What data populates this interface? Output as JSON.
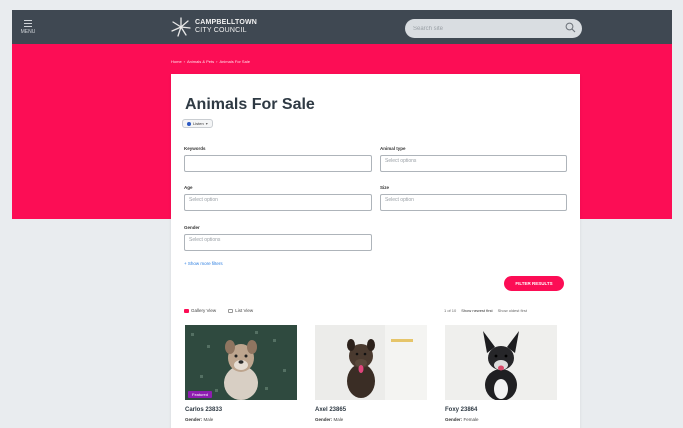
{
  "header": {
    "menu_label": "MENU",
    "logo_line1": "CAMPBELLTOWN",
    "logo_line2": "CITY COUNCIL",
    "search_placeholder": "Search site",
    "search_icon": "search-icon"
  },
  "breadcrumb": [
    "Home",
    "Animals & Pets",
    "Animals For Sale"
  ],
  "page": {
    "title": "Animals For Sale",
    "language_label": "Listen"
  },
  "filters": {
    "keywords": {
      "label": "Keywords",
      "value": "",
      "placeholder": ""
    },
    "animal_type": {
      "label": "Animal type",
      "placeholder": "Select options"
    },
    "age": {
      "label": "Age",
      "placeholder": "Select option"
    },
    "size": {
      "label": "Size",
      "placeholder": "Select option"
    },
    "gender": {
      "label": "Gender",
      "placeholder": "Select options"
    },
    "show_more": "+ Show more filters",
    "filter_button": "FILTER RESULTS"
  },
  "results": {
    "view_gallery": "Gallery View",
    "view_list": "List View",
    "count": "1 of 10",
    "sort_newest": "Show newest first",
    "sort_oldest": "Show oldest first"
  },
  "pets": [
    {
      "name": "Carlos 23833",
      "gender_label": "Gender:",
      "gender": "Male",
      "featured": "Featured"
    },
    {
      "name": "Axel 23865",
      "gender_label": "Gender:",
      "gender": "Male",
      "featured": ""
    },
    {
      "name": "Foxy 23864",
      "gender_label": "Gender:",
      "gender": "Female",
      "featured": ""
    }
  ],
  "colors": {
    "topbar": "#3f4852",
    "brand_pink": "#fc0d55",
    "featured_purple": "#8e1db0",
    "link_blue": "#2a7de1"
  }
}
